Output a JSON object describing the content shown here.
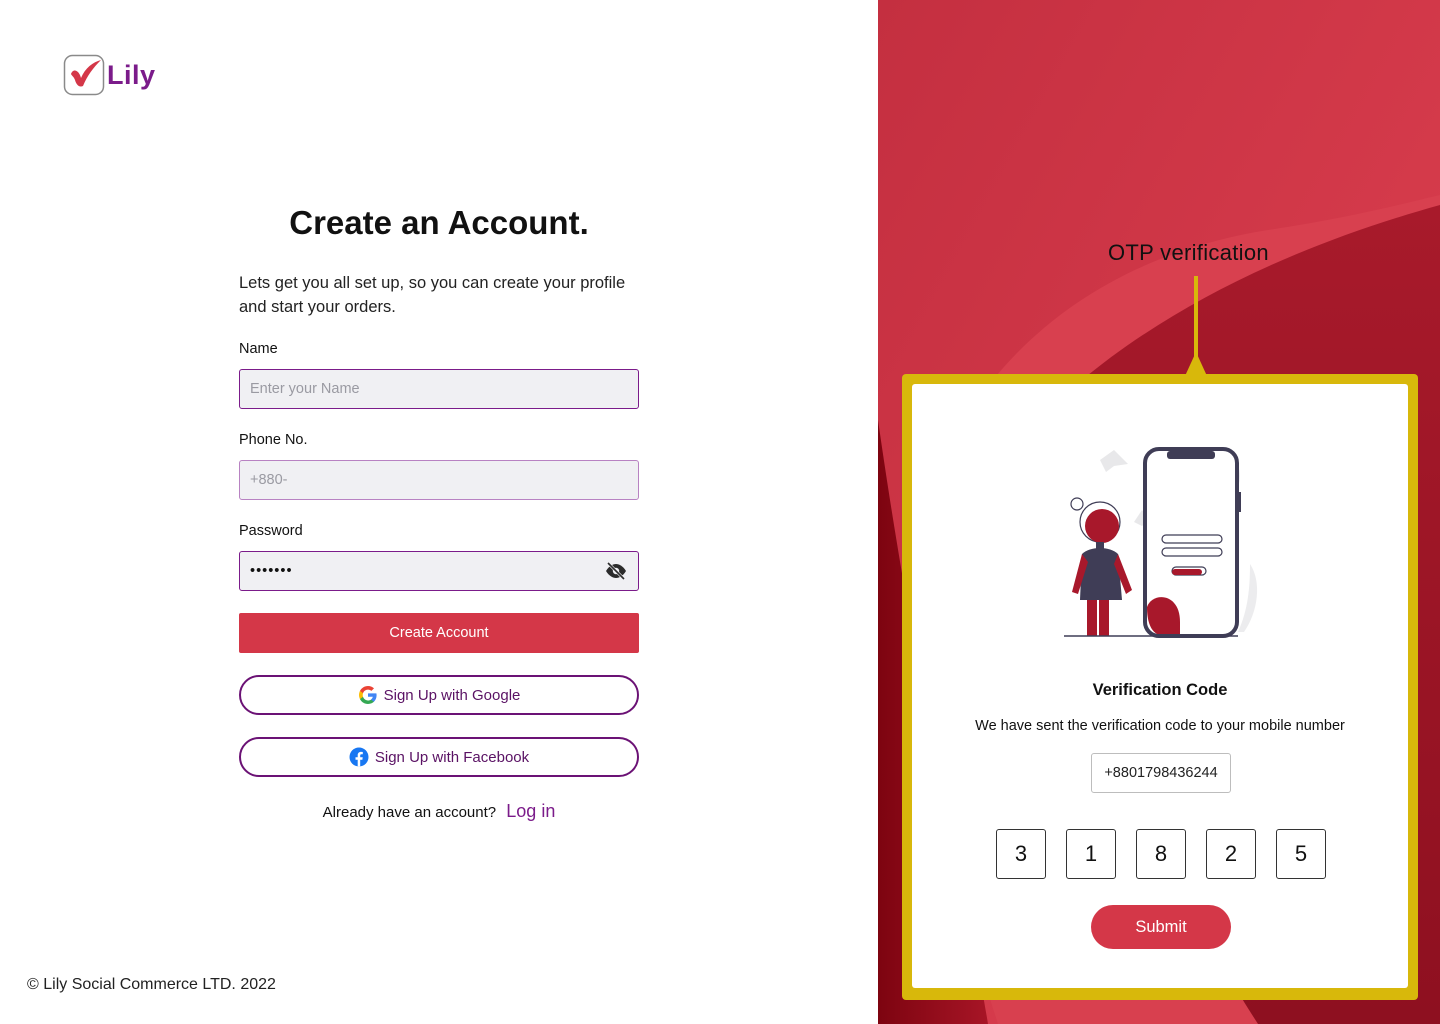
{
  "brand": {
    "name": "Lily",
    "primary": "#d43748",
    "accent": "#7b1b8a",
    "highlight": "#d8b80b"
  },
  "form": {
    "title": "Create an Account.",
    "subtitle": "Lets get you all set up, so you can create your profile and start your orders.",
    "name": {
      "label": "Name",
      "placeholder": "Enter your Name",
      "value": ""
    },
    "phone": {
      "label": "Phone No.",
      "placeholder": "+880-",
      "value": ""
    },
    "password": {
      "label": "Password",
      "value": "•••••••",
      "toggle_icon": "eye-slash-icon"
    },
    "create_button": "Create Account",
    "google_button": "Sign Up with Google",
    "facebook_button": "Sign Up with Facebook",
    "already_text": "Already have an account?",
    "login_link": "Log in"
  },
  "footer": {
    "copyright": "© Lily Social Commerce LTD. 2022"
  },
  "otp": {
    "annotation": "OTP verification",
    "title": "Verification Code",
    "message": "We have sent the verification code to your mobile number",
    "phone_number": "+8801798436244",
    "digits": [
      "3",
      "1",
      "8",
      "2",
      "5"
    ],
    "submit_button": "Submit"
  }
}
